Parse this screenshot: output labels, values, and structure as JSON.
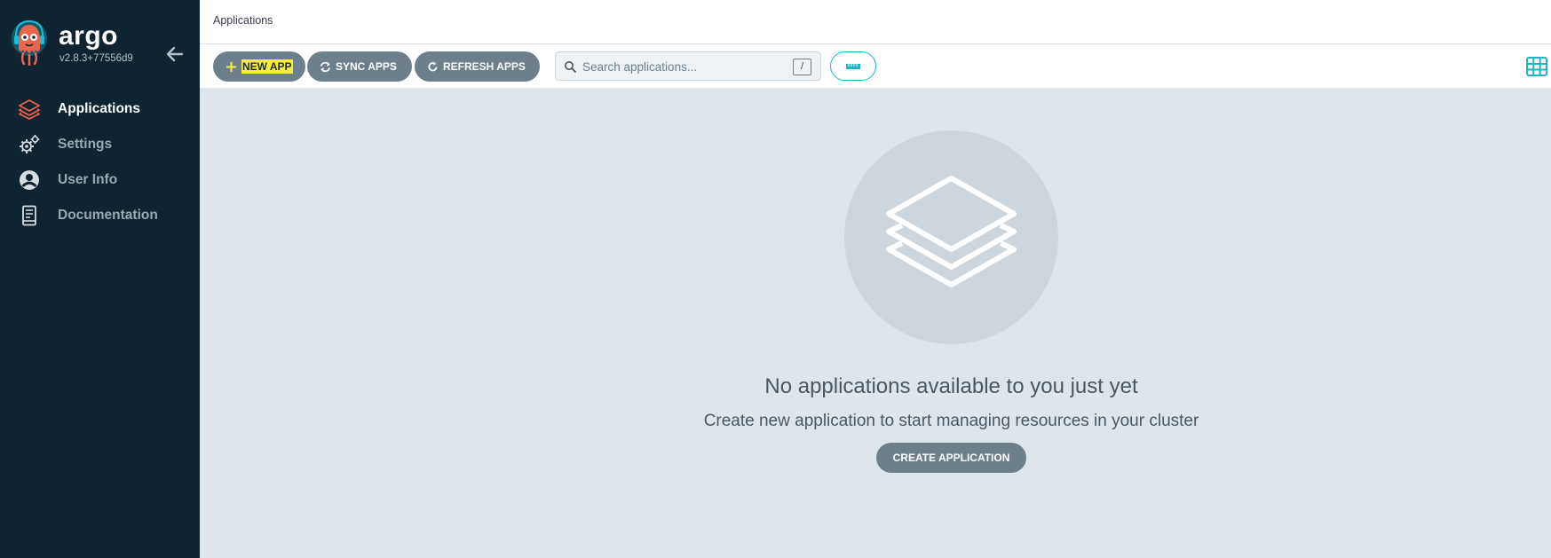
{
  "sidebar": {
    "brand_name": "argo",
    "version": "v2.8.3+77556d9",
    "items": [
      {
        "label": "Applications",
        "icon": "layers-icon",
        "active": true
      },
      {
        "label": "Settings",
        "icon": "gears-icon",
        "active": false
      },
      {
        "label": "User Info",
        "icon": "user-circle-icon",
        "active": false
      },
      {
        "label": "Documentation",
        "icon": "book-icon",
        "active": false
      }
    ]
  },
  "header": {
    "title": "Applications"
  },
  "toolbar": {
    "new_app_label": "NEW APP",
    "sync_apps_label": "SYNC APPS",
    "refresh_apps_label": "REFRESH APPS",
    "search_placeholder": "Search applications...",
    "search_value": "",
    "search_shortcut": "/"
  },
  "empty_state": {
    "title": "No applications available to you just yet",
    "subtitle": "Create new application to start managing resources in your cluster",
    "create_label": "CREATE APPLICATION"
  },
  "colors": {
    "sidebar_bg": "#0f2430",
    "accent": "#1fb5c9",
    "button_bg": "#6d7f8b",
    "highlight": "#f5ef3c",
    "main_bg": "#dee6eb",
    "active_icon": "#e9654b"
  }
}
